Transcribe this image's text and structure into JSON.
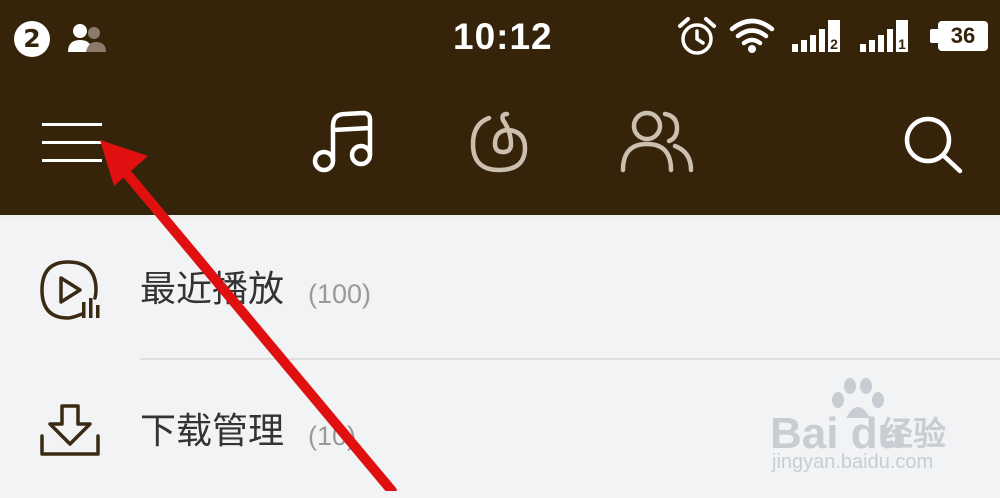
{
  "status_bar": {
    "notification_count": "2",
    "time": "10:12",
    "battery": "36",
    "sim1_label": "2",
    "sim2_label": "1",
    "icons": [
      "contacts-icon",
      "alarm-icon",
      "wifi-icon",
      "signal-icon",
      "signal-icon",
      "battery-icon"
    ]
  },
  "nav": {
    "icons": [
      "menu-icon",
      "music-note-icon",
      "netease-cloud-icon",
      "friends-icon",
      "search-icon"
    ],
    "active_tab": "music-note-icon"
  },
  "list": [
    {
      "label": "最近播放",
      "count": "(100)",
      "icon": "recent-play-icon"
    },
    {
      "label": "下载管理",
      "count": "(10)",
      "icon": "download-icon"
    }
  ],
  "watermark": {
    "brand": "Bai du",
    "brand_cn": "经验",
    "url": "jingyan.baidu.com"
  },
  "colors": {
    "header_bg": "#36240a",
    "content_bg": "#f2f3f5",
    "arrow": "#e01010",
    "icon_dark": "#3a2a14"
  }
}
